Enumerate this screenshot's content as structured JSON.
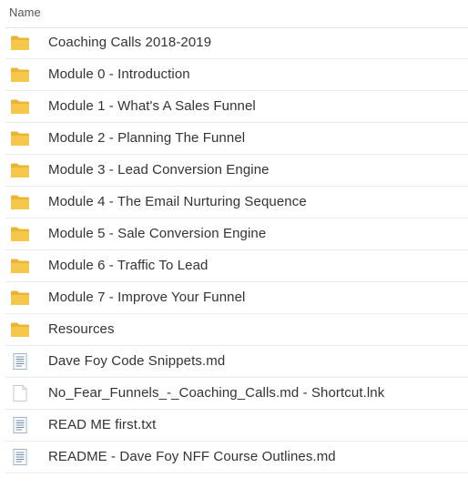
{
  "header": {
    "name_column": "Name"
  },
  "files": [
    {
      "name": "Coaching Calls 2018-2019",
      "icon": "folder-icon"
    },
    {
      "name": "Module 0 - Introduction",
      "icon": "folder-icon"
    },
    {
      "name": "Module 1 - What's A Sales Funnel",
      "icon": "folder-icon"
    },
    {
      "name": "Module 2 - Planning The Funnel",
      "icon": "folder-icon"
    },
    {
      "name": "Module 3 - Lead Conversion Engine",
      "icon": "folder-icon"
    },
    {
      "name": "Module 4 - The Email Nurturing Sequence",
      "icon": "folder-icon"
    },
    {
      "name": "Module 5 - Sale Conversion Engine",
      "icon": "folder-icon"
    },
    {
      "name": "Module 6 - Traffic To Lead",
      "icon": "folder-icon"
    },
    {
      "name": "Module 7 - Improve Your Funnel",
      "icon": "folder-icon"
    },
    {
      "name": "Resources",
      "icon": "folder-icon"
    },
    {
      "name": "Dave Foy Code Snippets.md",
      "icon": "text-file-icon"
    },
    {
      "name": "No_Fear_Funnels_-_Coaching_Calls.md - Shortcut.lnk",
      "icon": "blank-file-icon"
    },
    {
      "name": "READ ME first.txt",
      "icon": "text-file-icon"
    },
    {
      "name": "README - Dave Foy NFF Course Outlines.md",
      "icon": "text-file-icon"
    }
  ],
  "colors": {
    "folder_fill": "#f5c84c",
    "folder_tab": "#e9b437",
    "file_border": "#9fb3c8",
    "file_lines": "#6f8aa8",
    "divider": "#ebebeb",
    "text": "#333333"
  }
}
